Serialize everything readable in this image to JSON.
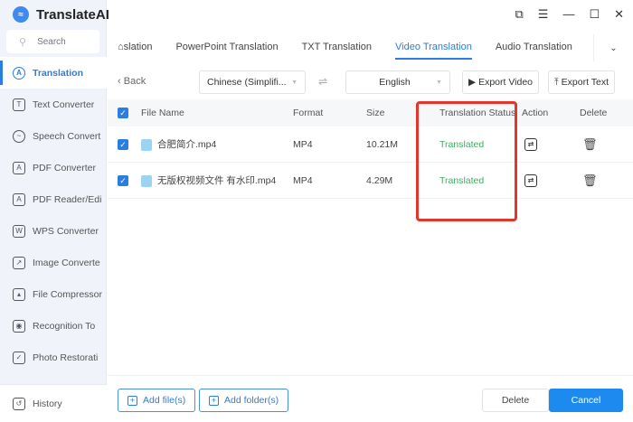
{
  "app": {
    "title": "TranslateAI"
  },
  "search": {
    "placeholder": "Search"
  },
  "sidebar": {
    "items": [
      {
        "label": "Translation",
        "icon": "translate-icon"
      },
      {
        "label": "Text Converter",
        "icon": "text-icon"
      },
      {
        "label": "Speech Convert",
        "icon": "speech-icon"
      },
      {
        "label": "PDF Converter",
        "icon": "pdf-icon"
      },
      {
        "label": "PDF Reader/Edi",
        "icon": "pdf-reader-icon"
      },
      {
        "label": "WPS Converter",
        "icon": "wps-icon"
      },
      {
        "label": "Image Converte",
        "icon": "image-icon"
      },
      {
        "label": "File Compressor",
        "icon": "compress-icon"
      },
      {
        "label": "Recognition To",
        "icon": "eye-icon"
      },
      {
        "label": "Photo Restorati",
        "icon": "photo-icon"
      }
    ],
    "history": "History"
  },
  "tabs": [
    {
      "label": "slation"
    },
    {
      "label": "PowerPoint Translation"
    },
    {
      "label": "TXT Translation"
    },
    {
      "label": "Video Translation",
      "active": true
    },
    {
      "label": "Audio Translation"
    }
  ],
  "toolbar": {
    "back": "Back",
    "source_lang": "Chinese (Simplifi...",
    "target_lang": "English",
    "export_video": "Export Video",
    "export_text": "Export Text"
  },
  "table": {
    "headers": {
      "name": "File Name",
      "format": "Format",
      "size": "Size",
      "status": "Translation Status",
      "action": "Action",
      "delete": "Delete"
    },
    "rows": [
      {
        "name": "合肥简介.mp4",
        "format": "MP4",
        "size": "10.21M",
        "status": "Translated"
      },
      {
        "name": "无版权视频文件 有水印.mp4",
        "format": "MP4",
        "size": "4.29M",
        "status": "Translated"
      }
    ]
  },
  "footer": {
    "add_files": "Add file(s)",
    "add_folders": "Add folder(s)",
    "delete": "Delete",
    "cancel": "Cancel"
  },
  "colors": {
    "accent": "#2a7de1",
    "translated": "#3fae62",
    "highlight": "#e0362c"
  }
}
